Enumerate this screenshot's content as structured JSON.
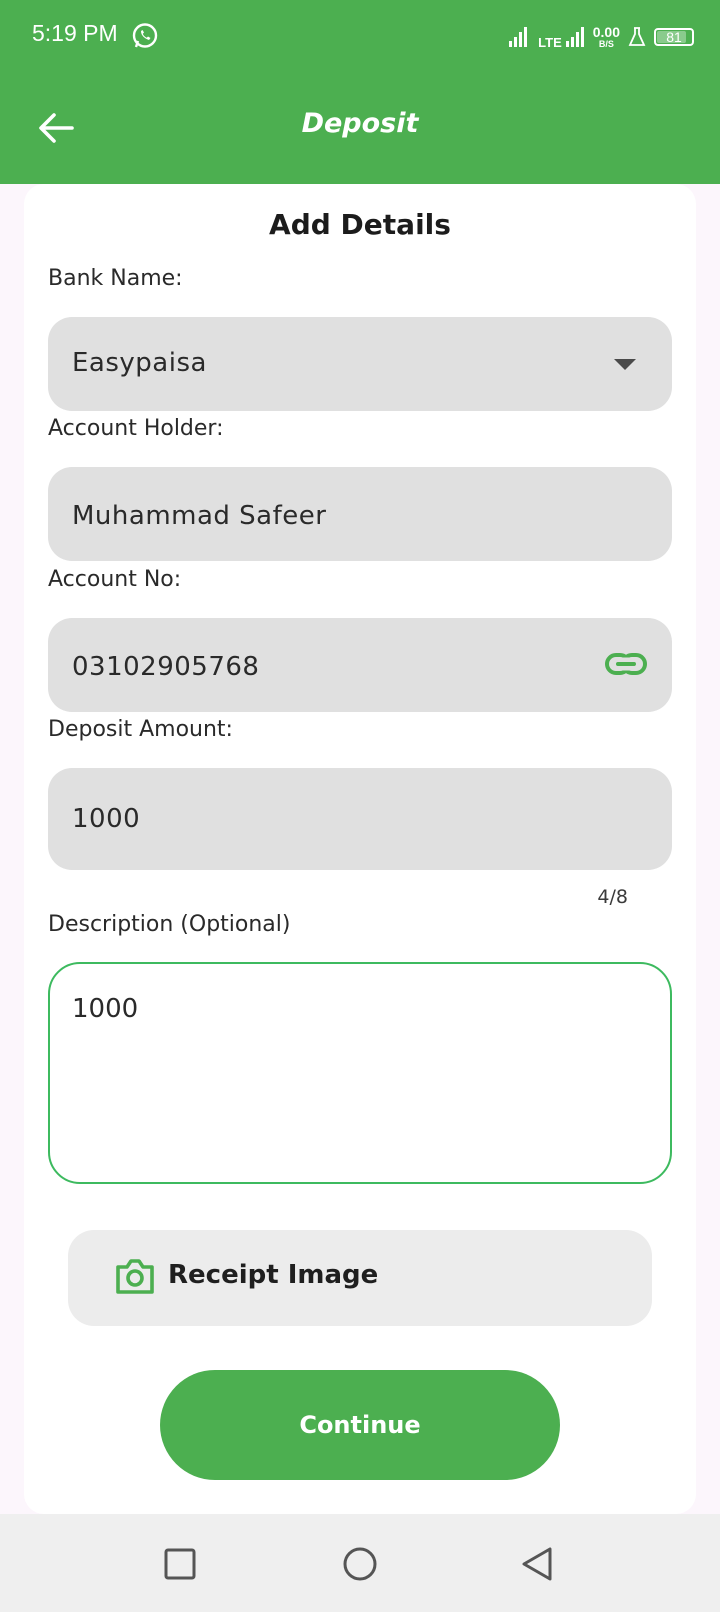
{
  "status_bar": {
    "time": "5:19 PM",
    "network_label": "LTE",
    "speed_value": "0.00",
    "speed_unit": "B/S",
    "battery_level": "81",
    "icons": [
      "whatsapp-icon",
      "signal-icon",
      "lte-signal-icon",
      "flask-icon",
      "battery-icon"
    ]
  },
  "app_bar": {
    "title": "Deposit",
    "back_icon": "arrow-left-icon"
  },
  "form": {
    "heading": "Add Details",
    "bank_name_label": "Bank Name:",
    "bank_name_value": "Easypaisa",
    "account_holder_label": "Account Holder:",
    "account_holder_value": "Muhammad Safeer",
    "account_no_label": "Account No:",
    "account_no_value": "03102905768",
    "deposit_amount_label": "Deposit Amount:",
    "deposit_amount_value": "1000",
    "char_counter": "4/8",
    "description_label": "Description (Optional)",
    "description_value": "1000",
    "receipt_label": "Receipt Image",
    "continue_label": "Continue"
  },
  "colors": {
    "brand_green": "#4caf50",
    "focus_border": "#3dba5f",
    "field_bg": "#e0e0e0"
  },
  "nav_bar": {
    "icons": [
      "recents-square-icon",
      "home-circle-icon",
      "back-triangle-icon"
    ]
  }
}
